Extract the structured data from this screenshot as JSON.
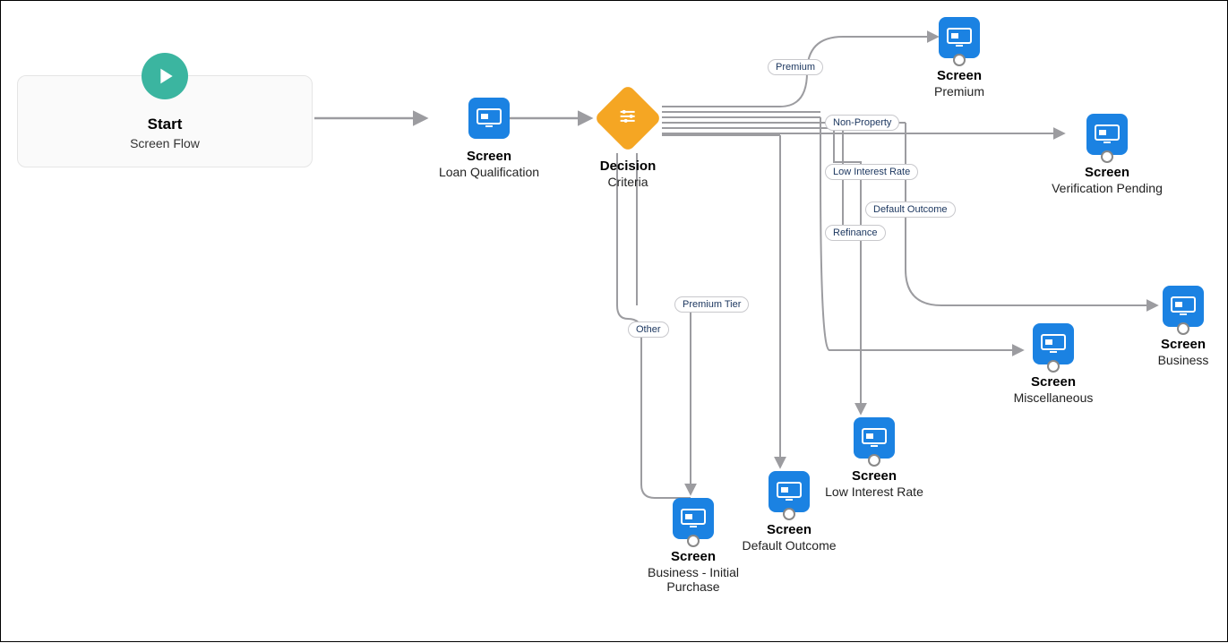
{
  "start": {
    "title": "Start",
    "subtitle": "Screen Flow"
  },
  "nodes": {
    "loanQual": {
      "title": "Screen",
      "subtitle": "Loan Qualification"
    },
    "decision": {
      "title": "Decision",
      "subtitle": "Criteria"
    },
    "premium": {
      "title": "Screen",
      "subtitle": "Premium"
    },
    "verification": {
      "title": "Screen",
      "subtitle": "Verification Pending"
    },
    "miscellaneous": {
      "title": "Screen",
      "subtitle": "Miscellaneous"
    },
    "business": {
      "title": "Screen",
      "subtitle": "Business"
    },
    "lowInterest": {
      "title": "Screen",
      "subtitle": "Low Interest Rate"
    },
    "defaultOutcome": {
      "title": "Screen",
      "subtitle": "Default Outcome"
    },
    "initialPurchase": {
      "title": "Screen",
      "subtitle": "Business - Initial\nPurchase"
    }
  },
  "badges": {
    "premium": "Premium",
    "nonProperty": "Non-Property",
    "lowInterest": "Low Interest Rate",
    "defaultOutcome": "Default Outcome",
    "refinance": "Refinance",
    "premiumTier": "Premium Tier",
    "other": "Other"
  }
}
